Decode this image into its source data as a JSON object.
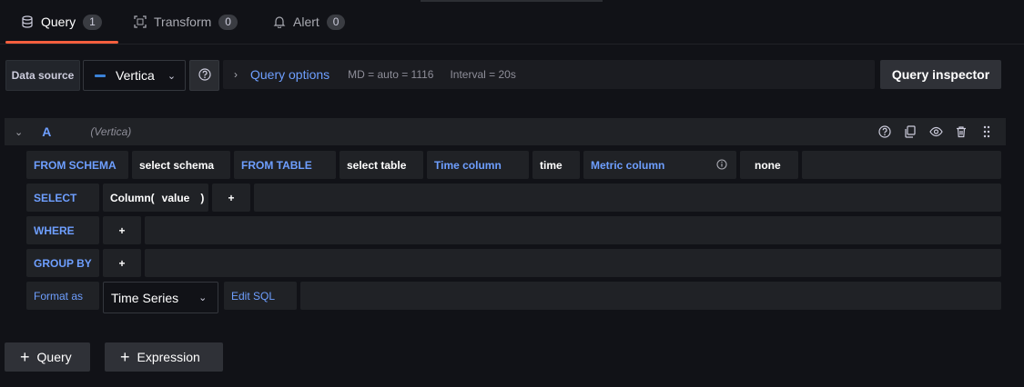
{
  "tabs": [
    {
      "label": "Query",
      "count": "1",
      "icon": "database-icon"
    },
    {
      "label": "Transform",
      "count": "0",
      "icon": "transform-icon"
    },
    {
      "label": "Alert",
      "count": "0",
      "icon": "bell-icon"
    }
  ],
  "query_options": {
    "datasource_label": "Data source",
    "datasource_value": "Vertica",
    "options_label": "Query options",
    "md": "MD = auto = 1116",
    "interval": "Interval = 20s",
    "inspector_label": "Query inspector"
  },
  "query": {
    "ref_id": "A",
    "datasource": "(Vertica)"
  },
  "builder": {
    "from_schema_label": "FROM SCHEMA",
    "schema_value": "select schema",
    "from_table_label": "FROM TABLE",
    "table_value": "select table",
    "time_column_label": "Time column",
    "time_column_value": "time",
    "metric_column_label": "Metric column",
    "metric_column_value": "none",
    "select_label": "SELECT",
    "select_column_func": "Column(",
    "select_column_arg": "value",
    "select_column_close": ")",
    "where_label": "WHERE",
    "group_by_label": "GROUP BY",
    "plus": "+",
    "format_as_label": "Format as",
    "format_value": "Time Series",
    "edit_sql_label": "Edit SQL"
  },
  "actions": {
    "add_query": "Query",
    "add_expression": "Expression"
  },
  "colors": {
    "accent": "#6e9fff",
    "tab_underline": "#f55f3e",
    "background": "#111217"
  }
}
